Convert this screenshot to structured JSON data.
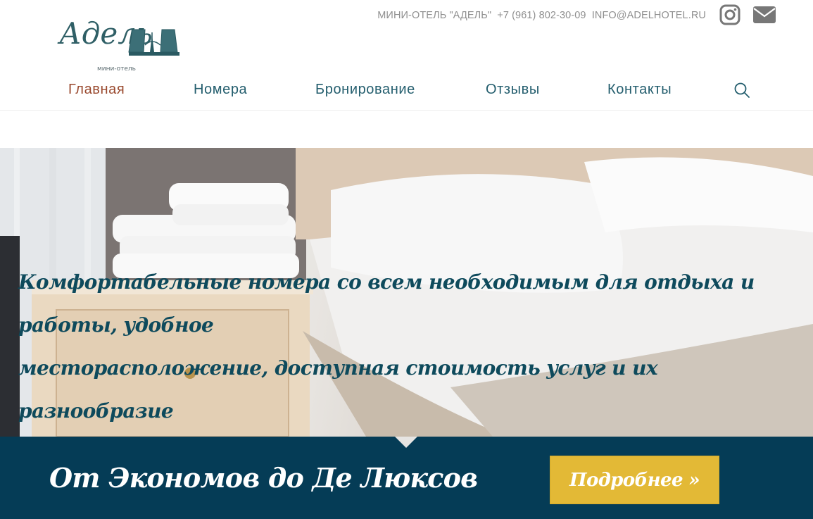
{
  "header": {
    "logo_script": "Адель",
    "logo_subtitle": "мини-отель",
    "contact": {
      "hotel_name": "МИНИ-ОТЕЛЬ \"АДЕЛЬ\"",
      "phone": "+7 (961) 802-30-09",
      "email": "INFO@ADELHOTEL.RU"
    },
    "social_icons": [
      "instagram-icon",
      "envelope-icon"
    ]
  },
  "nav": {
    "items": [
      {
        "label": "Главная",
        "active": true
      },
      {
        "label": "Номера",
        "active": false
      },
      {
        "label": "Бронирование",
        "active": false
      },
      {
        "label": "Отзывы",
        "active": false
      },
      {
        "label": "Контакты",
        "active": false
      }
    ],
    "search_icon": "search-icon"
  },
  "hero": {
    "line1": "Комфортабельные номера со всем необходимым для отдыха и работы, удобное",
    "line2": "месторасположение, доступная стоимость услуг и их разнообразие"
  },
  "band": {
    "title": "От Экономов до Де Люксов",
    "button_label": "Подробнее »"
  },
  "colors": {
    "accent_teal": "#245e6e",
    "active_nav": "#9a4a2f",
    "band_bg": "#053c56",
    "button_gold": "#e3b936"
  }
}
